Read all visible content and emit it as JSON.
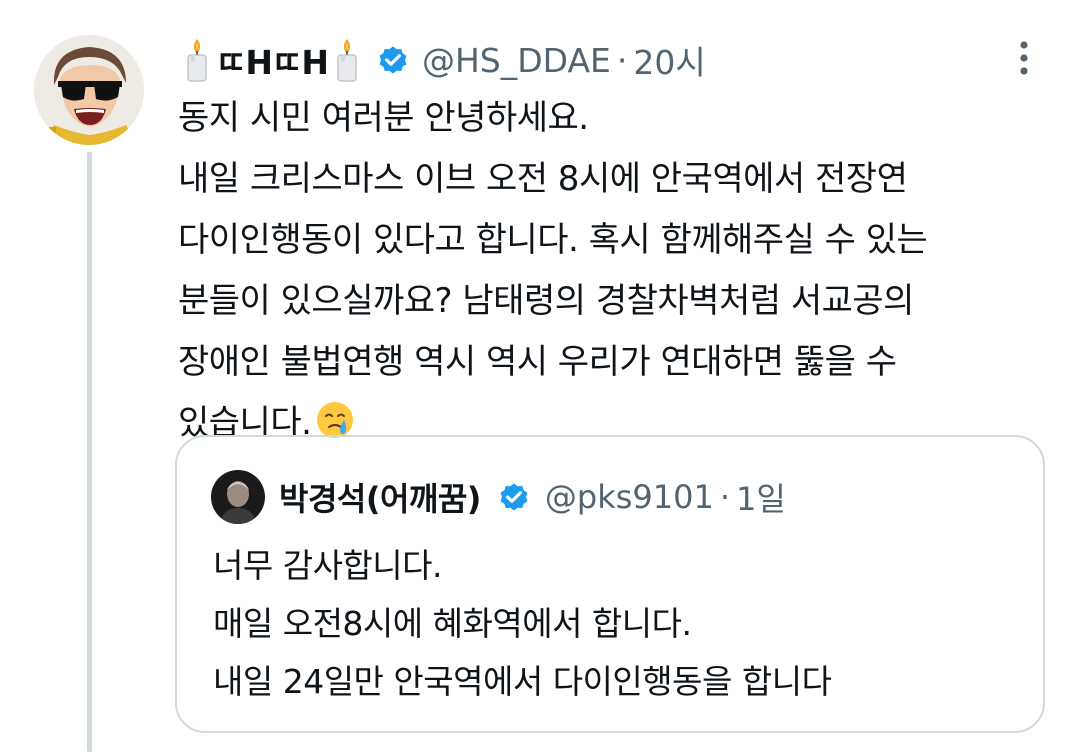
{
  "tweet": {
    "display_name": "ㄸHㄸH",
    "handle": "@HS_DDAE",
    "separator": "·",
    "time": "20시",
    "name_emoji": "candle-icon",
    "text_lines": [
      "동지 시민 여러분 안녕하세요.",
      "내일 크리스마스 이브 오전 8시에 안국역에서 전장연",
      "다이인행동이 있다고 합니다. 혹시 함께해주실 수 있는",
      "분들이 있으실까요? 남태령의 경찰차벽처럼 서교공의",
      "장애인 불법연행 역시 역시 우리가 연대하면 뚫을 수",
      "있습니다."
    ],
    "trailing_emoji": "face-holding-back-tears-icon"
  },
  "quote": {
    "display_name": "박경석(어깨꿈)",
    "handle": "@pks9101",
    "separator": "·",
    "time": "1일",
    "text_lines": [
      "너무 감사합니다.",
      "매일 오전8시에 혜화역에서 합니다.",
      "내일 24일만 안국역에서 다이인행동을 합니다"
    ]
  },
  "colors": {
    "verified": "#1d9bf0",
    "secondary_text": "#536471",
    "border": "#cfd9de",
    "primary_text": "#0f1419"
  }
}
